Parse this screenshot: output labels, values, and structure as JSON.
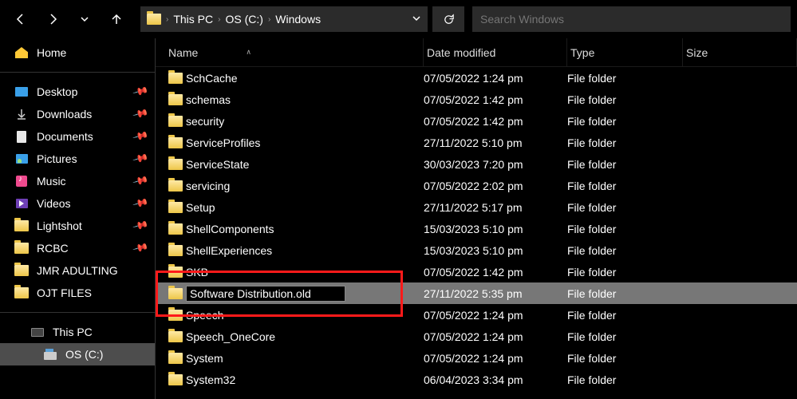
{
  "nav": {
    "back": "←",
    "forward": "→",
    "recent": "⌄",
    "up": "↑"
  },
  "breadcrumbs": [
    "This PC",
    "OS (C:)",
    "Windows"
  ],
  "search": {
    "placeholder": "Search Windows"
  },
  "sidebar": {
    "home": "Home",
    "quick": [
      {
        "label": "Desktop",
        "icon": "desktop",
        "pinned": true
      },
      {
        "label": "Downloads",
        "icon": "down",
        "pinned": true
      },
      {
        "label": "Documents",
        "icon": "doc",
        "pinned": true
      },
      {
        "label": "Pictures",
        "icon": "pic",
        "pinned": true
      },
      {
        "label": "Music",
        "icon": "music",
        "pinned": true
      },
      {
        "label": "Videos",
        "icon": "vid",
        "pinned": true
      },
      {
        "label": "Lightshot",
        "icon": "folder",
        "pinned": true
      },
      {
        "label": "RCBC",
        "icon": "folder",
        "pinned": true
      },
      {
        "label": "JMR ADULTING",
        "icon": "folder",
        "pinned": false
      },
      {
        "label": "OJT FILES",
        "icon": "folder",
        "pinned": false
      }
    ],
    "pc": "This PC",
    "drive": "OS (C:)"
  },
  "columns": {
    "name": "Name",
    "date": "Date modified",
    "type": "Type",
    "size": "Size"
  },
  "rows": [
    {
      "name": "SchCache",
      "date": "07/05/2022 1:24 pm",
      "type": "File folder"
    },
    {
      "name": "schemas",
      "date": "07/05/2022 1:42 pm",
      "type": "File folder"
    },
    {
      "name": "security",
      "date": "07/05/2022 1:42 pm",
      "type": "File folder"
    },
    {
      "name": "ServiceProfiles",
      "date": "27/11/2022 5:10 pm",
      "type": "File folder"
    },
    {
      "name": "ServiceState",
      "date": "30/03/2023 7:20 pm",
      "type": "File folder"
    },
    {
      "name": "servicing",
      "date": "07/05/2022 2:02 pm",
      "type": "File folder"
    },
    {
      "name": "Setup",
      "date": "27/11/2022 5:17 pm",
      "type": "File folder"
    },
    {
      "name": "ShellComponents",
      "date": "15/03/2023 5:10 pm",
      "type": "File folder"
    },
    {
      "name": "ShellExperiences",
      "date": "15/03/2023 5:10 pm",
      "type": "File folder"
    },
    {
      "name": "SKB",
      "date": "07/05/2022 1:42 pm",
      "type": "File folder"
    },
    {
      "name": "Software Distribution.old",
      "date": "27/11/2022 5:35 pm",
      "type": "File folder",
      "renaming": true,
      "selected": true
    },
    {
      "name": "Speech",
      "date": "07/05/2022 1:24 pm",
      "type": "File folder"
    },
    {
      "name": "Speech_OneCore",
      "date": "07/05/2022 1:24 pm",
      "type": "File folder"
    },
    {
      "name": "System",
      "date": "07/05/2022 1:24 pm",
      "type": "File folder"
    },
    {
      "name": "System32",
      "date": "06/04/2023 3:34 pm",
      "type": "File folder"
    }
  ],
  "highlight_row_index": 10
}
